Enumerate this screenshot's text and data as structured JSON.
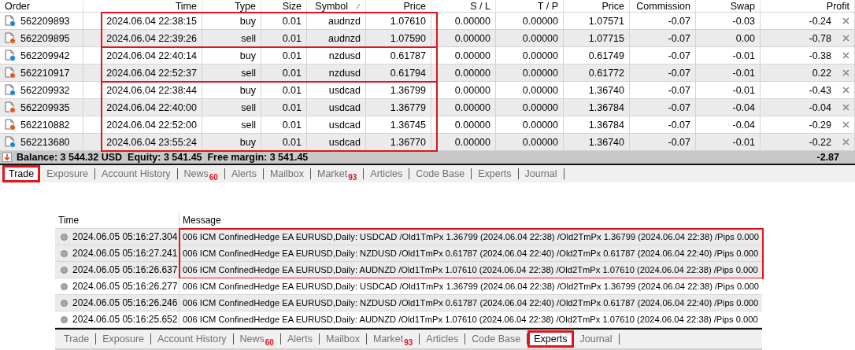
{
  "trade": {
    "columns": [
      "Order",
      "Time",
      "Type",
      "Size",
      "Symbol",
      "Price",
      "S / L",
      "T / P",
      "Price",
      "Commission",
      "Swap",
      "Profit"
    ],
    "sorted_column_marker": true,
    "groups": [
      {
        "highlighted": true,
        "rows": [
          {
            "kind": "buy",
            "cells": [
              "562209893",
              "2024.06.04 22:38:15",
              "buy",
              "0.01",
              "audnzd",
              "1.07610",
              "0.00000",
              "0.00000",
              "1.07571",
              "-0.07",
              "-0.03",
              "-0.24"
            ]
          },
          {
            "kind": "sell",
            "cells": [
              "562209895",
              "2024.06.04 22:39:26",
              "sell",
              "0.01",
              "audnzd",
              "1.07590",
              "0.00000",
              "0.00000",
              "1.07715",
              "-0.07",
              "0.00",
              "-0.78"
            ]
          }
        ]
      },
      {
        "highlighted": true,
        "rows": [
          {
            "kind": "buy",
            "cells": [
              "562209942",
              "2024.06.04 22:40:14",
              "buy",
              "0.01",
              "nzdusd",
              "0.61787",
              "0.00000",
              "0.00000",
              "0.61749",
              "-0.07",
              "-0.01",
              "-0.38"
            ]
          },
          {
            "kind": "sell",
            "cells": [
              "562210917",
              "2024.06.04 22:52:37",
              "sell",
              "0.01",
              "nzdusd",
              "0.61794",
              "0.00000",
              "0.00000",
              "0.61772",
              "-0.07",
              "-0.01",
              "0.22"
            ]
          }
        ]
      },
      {
        "highlighted": true,
        "rows": [
          {
            "kind": "buy",
            "cells": [
              "562209932",
              "2024.06.04 22:38:44",
              "buy",
              "0.01",
              "usdcad",
              "1.36799",
              "0.00000",
              "0.00000",
              "1.36740",
              "-0.07",
              "-0.01",
              "-0.43"
            ]
          },
          {
            "kind": "sell",
            "cells": [
              "562209935",
              "2024.06.04 22:40:00",
              "sell",
              "0.01",
              "usdcad",
              "1.36779",
              "0.00000",
              "0.00000",
              "1.36784",
              "-0.07",
              "-0.04",
              "-0.04"
            ]
          },
          {
            "kind": "sell",
            "cells": [
              "562210882",
              "2024.06.04 22:52:00",
              "sell",
              "0.01",
              "usdcad",
              "1.36745",
              "0.00000",
              "0.00000",
              "1.36784",
              "-0.07",
              "-0.04",
              "-0.29"
            ]
          },
          {
            "kind": "buy",
            "cells": [
              "562213680",
              "2024.06.04 23:55:24",
              "buy",
              "0.01",
              "usdcad",
              "1.36770",
              "0.00000",
              "0.00000",
              "1.36740",
              "-0.07",
              "-0.01",
              "-0.22"
            ]
          }
        ]
      }
    ],
    "summary": {
      "text": "Balance: 3 544.32 USD  Equity: 3 541.45  Free margin: 3 541.45",
      "total": "-2.87"
    }
  },
  "top_tabs": [
    {
      "label": "Trade",
      "selected": true,
      "highlighted": true
    },
    {
      "label": "Exposure",
      "selected": false,
      "highlighted": false
    },
    {
      "label": "Account History",
      "selected": false,
      "highlighted": false
    },
    {
      "label": "News",
      "badge": "60",
      "selected": false,
      "highlighted": false
    },
    {
      "label": "Alerts",
      "selected": false,
      "highlighted": false
    },
    {
      "label": "Mailbox",
      "selected": false,
      "highlighted": false
    },
    {
      "label": "Market",
      "badge": "93",
      "selected": false,
      "highlighted": false
    },
    {
      "label": "Articles",
      "selected": false,
      "highlighted": false
    },
    {
      "label": "Code Base",
      "selected": false,
      "highlighted": false
    },
    {
      "label": "Experts",
      "selected": false,
      "highlighted": false
    },
    {
      "label": "Journal",
      "selected": false,
      "highlighted": false
    }
  ],
  "log": {
    "columns": [
      "Time",
      "Message"
    ],
    "groups": [
      {
        "highlighted": true,
        "rows": [
          {
            "time": "2024.06.05 05:16:27.304",
            "message": "006 ICM ConfinedHedge EA EURUSD,Daily: USDCAD /Old1TmPx 1.36799 (2024.06.04 22:38) /Old2TmPx 1.36799 (2024.06.04 22:38) /Pips 0.000"
          },
          {
            "time": "2024.06.05 05:16:27.241",
            "message": "006 ICM ConfinedHedge EA EURUSD,Daily: NZDUSD /Old1TmPx 0.61787 (2024.06.04 22:40) /Old2TmPx 0.61787 (2024.06.04 22:40) /Pips 0.000"
          },
          {
            "time": "2024.06.05 05:16:26.637",
            "message": "006 ICM ConfinedHedge EA EURUSD,Daily: AUDNZD /Old1TmPx 1.07610 (2024.06.04 22:38) /Old2TmPx 1.07610 (2024.06.04 22:38) /Pips 0.000"
          }
        ]
      },
      {
        "highlighted": false,
        "rows": [
          {
            "time": "2024.06.05 05:16:26.277",
            "message": "006 ICM ConfinedHedge EA EURUSD,Daily: USDCAD /Old1TmPx 1.36799 (2024.06.04 22:38) /Old2TmPx 1.36799 (2024.06.04 22:38) /Pips 0.000"
          },
          {
            "time": "2024.06.05 05:16:26.246",
            "message": "006 ICM ConfinedHedge EA EURUSD,Daily: NZDUSD /Old1TmPx 0.61787 (2024.06.04 22:40) /Old2TmPx 0.61787 (2024.06.04 22:40) /Pips 0.000"
          },
          {
            "time": "2024.06.05 05:16:25.652",
            "message": "006 ICM ConfinedHedge EA EURUSD,Daily: AUDNZD /Old1TmPx 1.07610 (2024.06.04 22:38) /Old2TmPx 1.07610 (2024.06.04 22:38) /Pips 0.000"
          }
        ]
      }
    ]
  },
  "bottom_tabs": [
    {
      "label": "Trade",
      "selected": false,
      "highlighted": false
    },
    {
      "label": "Exposure",
      "selected": false,
      "highlighted": false
    },
    {
      "label": "Account History",
      "selected": false,
      "highlighted": false
    },
    {
      "label": "News",
      "badge": "60",
      "selected": false,
      "highlighted": false
    },
    {
      "label": "Alerts",
      "selected": false,
      "highlighted": false
    },
    {
      "label": "Mailbox",
      "selected": false,
      "highlighted": false
    },
    {
      "label": "Market",
      "badge": "93",
      "selected": false,
      "highlighted": false
    },
    {
      "label": "Articles",
      "selected": false,
      "highlighted": false
    },
    {
      "label": "Code Base",
      "selected": false,
      "highlighted": false
    },
    {
      "label": "Experts",
      "selected": true,
      "highlighted": true
    },
    {
      "label": "Journal",
      "selected": false,
      "highlighted": false
    }
  ]
}
